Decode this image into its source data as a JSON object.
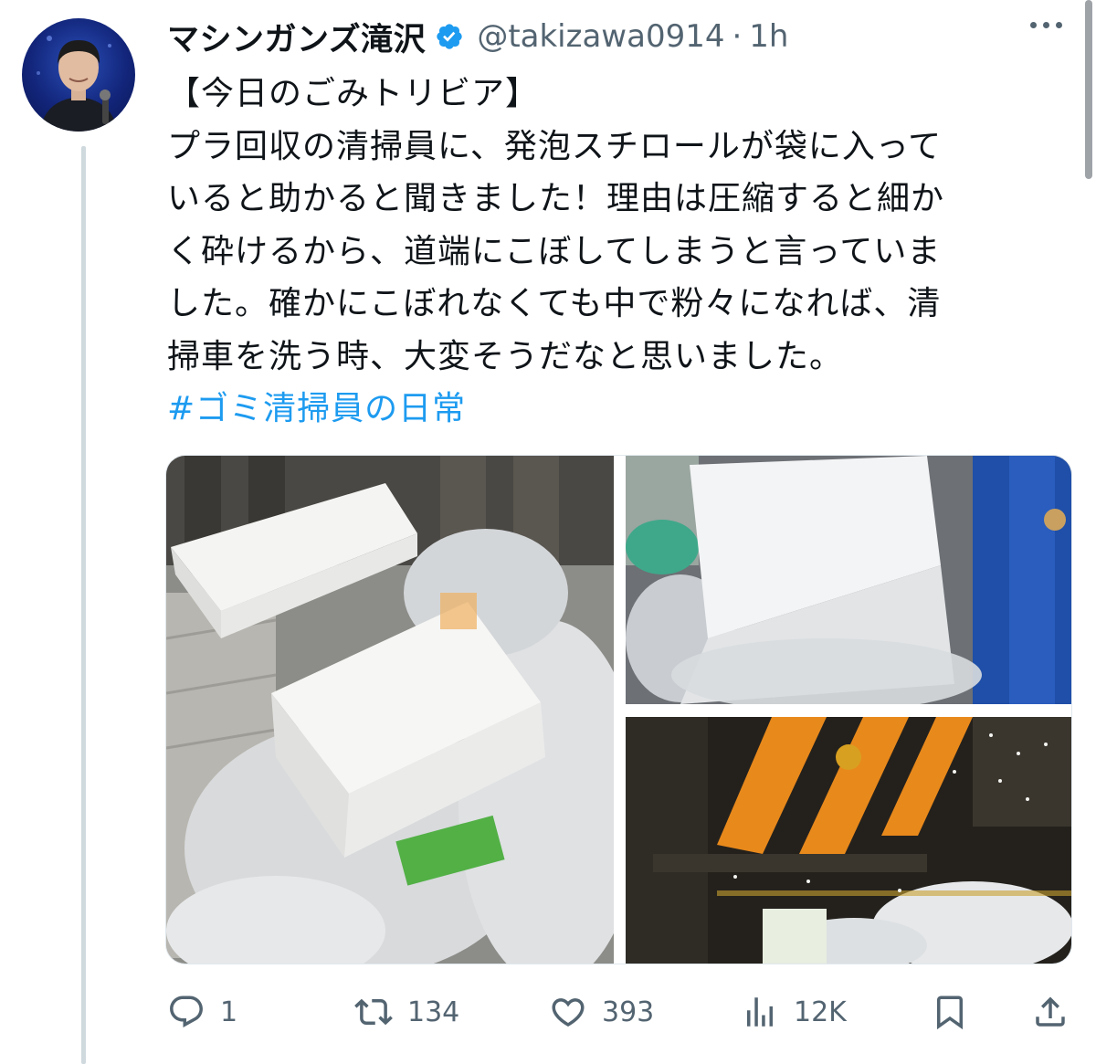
{
  "tweet": {
    "display_name": "マシンガンズ滝沢",
    "handle": "@takizawa0914",
    "separator": "·",
    "time": "1h",
    "verified_icon": "verified-badge-icon",
    "text_lines": [
      "【今日のごみトリビア】",
      "プラ回収の清掃員に、発泡スチロールが袋に入って",
      "いると助かると聞きました！理由は圧縮すると細か",
      "く砕けるから、道端にこぼしてしまうと言っていま",
      "した。確かにこぼれなくても中で粉々になれば、清",
      "掃車を洗う時、大変そうだなと思いました。"
    ],
    "hashtag": "#ゴミ清掃員の日常",
    "hashtag_color": "#1d9bf0"
  },
  "actions": {
    "reply_count": "1",
    "retweet_count": "134",
    "like_count": "393",
    "views_count": "12K"
  },
  "icons": [
    "reply-icon",
    "retweet-icon",
    "like-icon",
    "views-icon",
    "bookmark-icon",
    "share-icon",
    "more-icon"
  ],
  "colors": {
    "text": "#0f1419",
    "secondary": "#536471",
    "link": "#1d9bf0",
    "thread_line": "#cfd9de"
  }
}
